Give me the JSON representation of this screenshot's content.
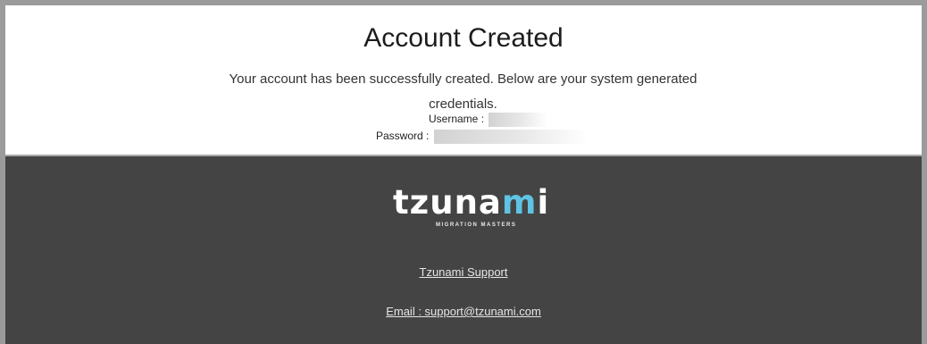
{
  "card": {
    "title": "Account Created",
    "message": "Your account has been successfully created. Below are your system generated credentials.",
    "username_label": "Username :",
    "password_label": "Password :"
  },
  "footer": {
    "logo_text_main": "tzuna",
    "logo_text_accent": "m",
    "logo_text_end": "i",
    "logo_tagline": "MIGRATION MASTERS",
    "support_link": "Tzunami Support",
    "email_link": "Email : support@tzunami.com"
  },
  "colors": {
    "footer_bg": "#444444",
    "logo_accent": "#5fc3e4",
    "frame_border": "#9b9b9b"
  }
}
